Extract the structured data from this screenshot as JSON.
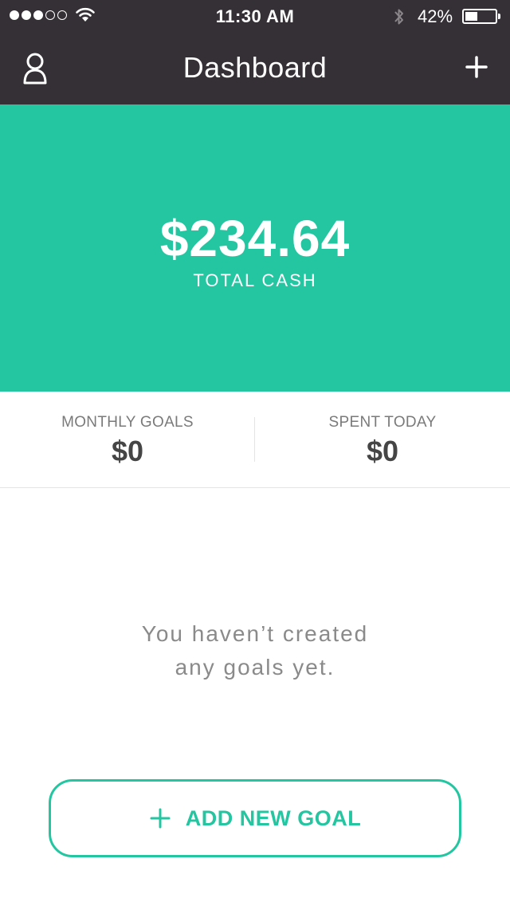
{
  "status_bar": {
    "time": "11:30 AM",
    "battery_percent": "42%",
    "battery_level": 0.42,
    "signal_bars_filled": 3,
    "signal_bars_total": 5
  },
  "nav": {
    "title": "Dashboard",
    "left_icon": "profile-icon",
    "right_icon": "plus-icon"
  },
  "hero": {
    "amount": "$234.64",
    "label": "TOTAL CASH"
  },
  "stats": {
    "monthly_goals": {
      "label": "MONTHLY GOALS",
      "value": "$0"
    },
    "spent_today": {
      "label": "SPENT TODAY",
      "value": "$0"
    }
  },
  "empty_state": {
    "line1": "You haven’t created",
    "line2": "any goals yet."
  },
  "add_goal_button": {
    "label": "ADD NEW GOAL",
    "icon": "plus-icon"
  },
  "colors": {
    "accent": "#23c6a0",
    "header_bg": "#353035"
  }
}
